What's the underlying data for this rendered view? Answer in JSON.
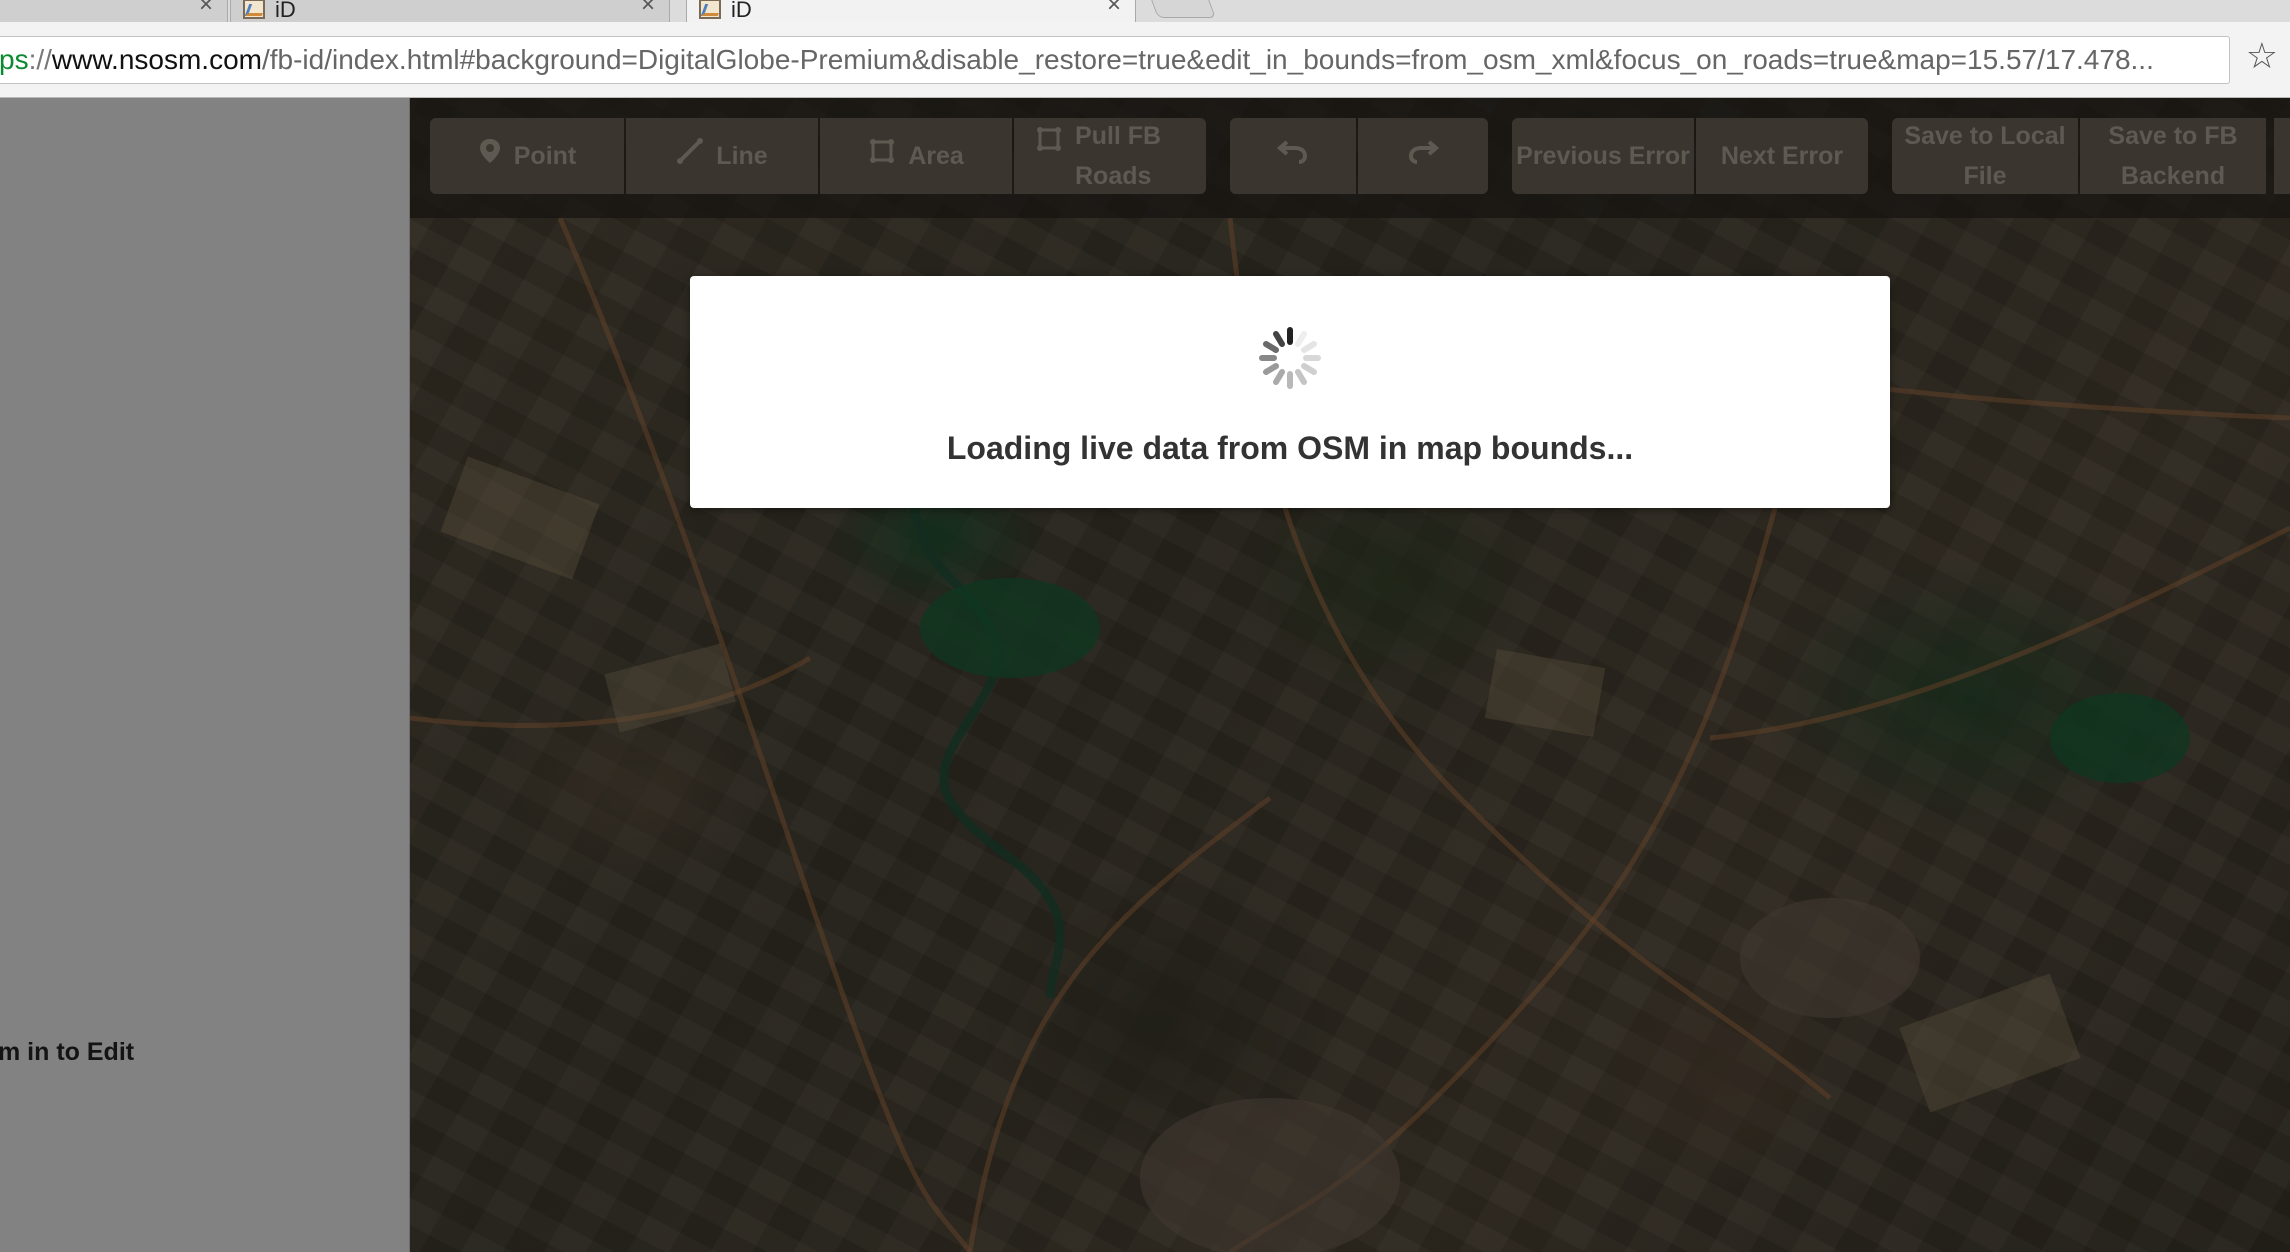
{
  "browser": {
    "tabs": [
      {
        "title": "iD",
        "active": false
      },
      {
        "title": "iD",
        "active": true
      }
    ],
    "close_glyph": "×",
    "address": {
      "scheme": "ps",
      "separator": "://",
      "host": "www.nsosm.com",
      "rest": "/fb-id/index.html#background=DigitalGlobe-Premium&disable_restore=true&edit_in_bounds=from_osm_xml&focus_on_roads=true&map=15.57/17.478..."
    },
    "bookmark_icon": "star-icon",
    "star_glyph": "☆"
  },
  "sidebar": {
    "zoom_hint": "m in to Edit"
  },
  "toolbar": {
    "modes": [
      {
        "label": "Point",
        "icon": "marker-icon"
      },
      {
        "label": "Line",
        "icon": "line-icon"
      },
      {
        "label": "Area",
        "icon": "area-icon"
      },
      {
        "label": "Pull FB Roads",
        "icon": "area-icon"
      }
    ],
    "history": [
      {
        "name": "undo",
        "icon": "undo-icon"
      },
      {
        "name": "redo",
        "icon": "redo-icon"
      }
    ],
    "previous_error": "Previous Error",
    "next_error": "Next Error",
    "save_local_line1": "Save to Local",
    "save_local_line2": "File",
    "save_fb_line1": "Save to FB",
    "save_fb_line2": "Backend"
  },
  "modal": {
    "message": "Loading live data from OSM in map bounds..."
  }
}
